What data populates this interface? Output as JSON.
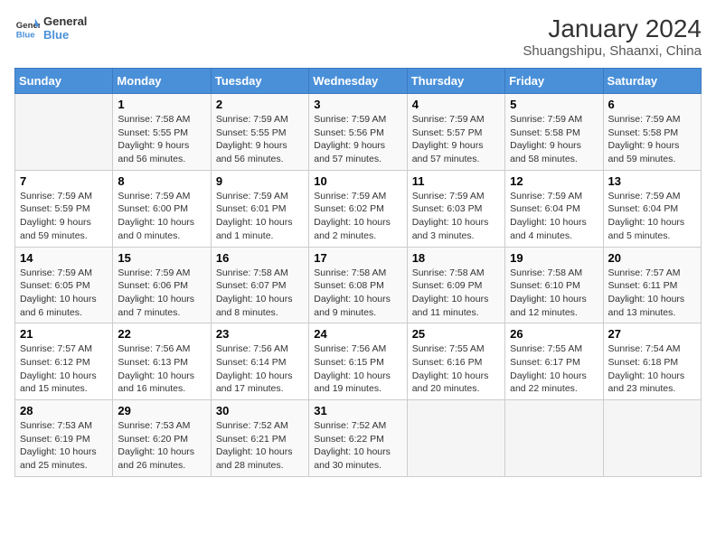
{
  "logo": {
    "name_part1": "General",
    "name_part2": "Blue"
  },
  "title": "January 2024",
  "subtitle": "Shuangshipu, Shaanxi, China",
  "days_of_week": [
    "Sunday",
    "Monday",
    "Tuesday",
    "Wednesday",
    "Thursday",
    "Friday",
    "Saturday"
  ],
  "weeks": [
    [
      {
        "day": "",
        "info": ""
      },
      {
        "day": "1",
        "info": "Sunrise: 7:58 AM\nSunset: 5:55 PM\nDaylight: 9 hours\nand 56 minutes."
      },
      {
        "day": "2",
        "info": "Sunrise: 7:59 AM\nSunset: 5:55 PM\nDaylight: 9 hours\nand 56 minutes."
      },
      {
        "day": "3",
        "info": "Sunrise: 7:59 AM\nSunset: 5:56 PM\nDaylight: 9 hours\nand 57 minutes."
      },
      {
        "day": "4",
        "info": "Sunrise: 7:59 AM\nSunset: 5:57 PM\nDaylight: 9 hours\nand 57 minutes."
      },
      {
        "day": "5",
        "info": "Sunrise: 7:59 AM\nSunset: 5:58 PM\nDaylight: 9 hours\nand 58 minutes."
      },
      {
        "day": "6",
        "info": "Sunrise: 7:59 AM\nSunset: 5:58 PM\nDaylight: 9 hours\nand 59 minutes."
      }
    ],
    [
      {
        "day": "7",
        "info": "Sunrise: 7:59 AM\nSunset: 5:59 PM\nDaylight: 9 hours\nand 59 minutes."
      },
      {
        "day": "8",
        "info": "Sunrise: 7:59 AM\nSunset: 6:00 PM\nDaylight: 10 hours\nand 0 minutes."
      },
      {
        "day": "9",
        "info": "Sunrise: 7:59 AM\nSunset: 6:01 PM\nDaylight: 10 hours\nand 1 minute."
      },
      {
        "day": "10",
        "info": "Sunrise: 7:59 AM\nSunset: 6:02 PM\nDaylight: 10 hours\nand 2 minutes."
      },
      {
        "day": "11",
        "info": "Sunrise: 7:59 AM\nSunset: 6:03 PM\nDaylight: 10 hours\nand 3 minutes."
      },
      {
        "day": "12",
        "info": "Sunrise: 7:59 AM\nSunset: 6:04 PM\nDaylight: 10 hours\nand 4 minutes."
      },
      {
        "day": "13",
        "info": "Sunrise: 7:59 AM\nSunset: 6:04 PM\nDaylight: 10 hours\nand 5 minutes."
      }
    ],
    [
      {
        "day": "14",
        "info": "Sunrise: 7:59 AM\nSunset: 6:05 PM\nDaylight: 10 hours\nand 6 minutes."
      },
      {
        "day": "15",
        "info": "Sunrise: 7:59 AM\nSunset: 6:06 PM\nDaylight: 10 hours\nand 7 minutes."
      },
      {
        "day": "16",
        "info": "Sunrise: 7:58 AM\nSunset: 6:07 PM\nDaylight: 10 hours\nand 8 minutes."
      },
      {
        "day": "17",
        "info": "Sunrise: 7:58 AM\nSunset: 6:08 PM\nDaylight: 10 hours\nand 9 minutes."
      },
      {
        "day": "18",
        "info": "Sunrise: 7:58 AM\nSunset: 6:09 PM\nDaylight: 10 hours\nand 11 minutes."
      },
      {
        "day": "19",
        "info": "Sunrise: 7:58 AM\nSunset: 6:10 PM\nDaylight: 10 hours\nand 12 minutes."
      },
      {
        "day": "20",
        "info": "Sunrise: 7:57 AM\nSunset: 6:11 PM\nDaylight: 10 hours\nand 13 minutes."
      }
    ],
    [
      {
        "day": "21",
        "info": "Sunrise: 7:57 AM\nSunset: 6:12 PM\nDaylight: 10 hours\nand 15 minutes."
      },
      {
        "day": "22",
        "info": "Sunrise: 7:56 AM\nSunset: 6:13 PM\nDaylight: 10 hours\nand 16 minutes."
      },
      {
        "day": "23",
        "info": "Sunrise: 7:56 AM\nSunset: 6:14 PM\nDaylight: 10 hours\nand 17 minutes."
      },
      {
        "day": "24",
        "info": "Sunrise: 7:56 AM\nSunset: 6:15 PM\nDaylight: 10 hours\nand 19 minutes."
      },
      {
        "day": "25",
        "info": "Sunrise: 7:55 AM\nSunset: 6:16 PM\nDaylight: 10 hours\nand 20 minutes."
      },
      {
        "day": "26",
        "info": "Sunrise: 7:55 AM\nSunset: 6:17 PM\nDaylight: 10 hours\nand 22 minutes."
      },
      {
        "day": "27",
        "info": "Sunrise: 7:54 AM\nSunset: 6:18 PM\nDaylight: 10 hours\nand 23 minutes."
      }
    ],
    [
      {
        "day": "28",
        "info": "Sunrise: 7:53 AM\nSunset: 6:19 PM\nDaylight: 10 hours\nand 25 minutes."
      },
      {
        "day": "29",
        "info": "Sunrise: 7:53 AM\nSunset: 6:20 PM\nDaylight: 10 hours\nand 26 minutes."
      },
      {
        "day": "30",
        "info": "Sunrise: 7:52 AM\nSunset: 6:21 PM\nDaylight: 10 hours\nand 28 minutes."
      },
      {
        "day": "31",
        "info": "Sunrise: 7:52 AM\nSunset: 6:22 PM\nDaylight: 10 hours\nand 30 minutes."
      },
      {
        "day": "",
        "info": ""
      },
      {
        "day": "",
        "info": ""
      },
      {
        "day": "",
        "info": ""
      }
    ]
  ]
}
